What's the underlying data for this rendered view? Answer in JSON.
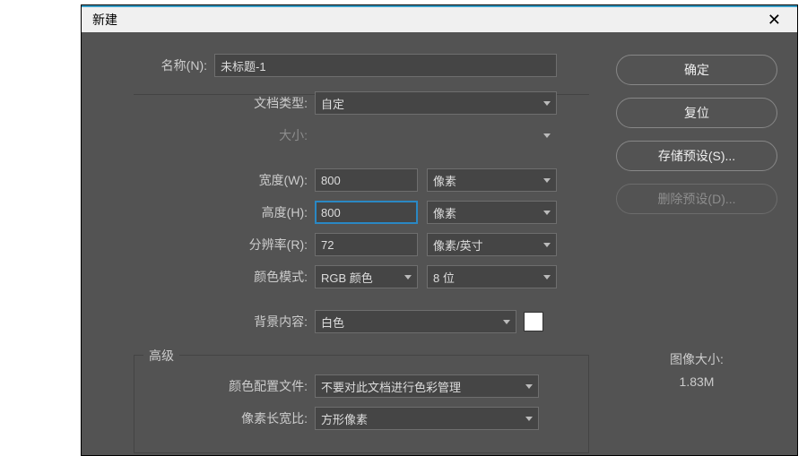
{
  "titlebar": {
    "title": "新建"
  },
  "labels": {
    "name": "名称(N):",
    "docType": "文档类型:",
    "size": "大小:",
    "width": "宽度(W):",
    "height": "高度(H):",
    "resolution": "分辨率(R):",
    "colorMode": "颜色模式:",
    "bgContent": "背景内容:",
    "advanced": "高级",
    "colorProfile": "颜色配置文件:",
    "pixelAspect": "像素长宽比:"
  },
  "values": {
    "name": "未标题-1",
    "docType": "自定",
    "width": "800",
    "widthUnit": "像素",
    "height": "800",
    "heightUnit": "像素",
    "resolution": "72",
    "resUnit": "像素/英寸",
    "colorMode": "RGB 颜色",
    "bitDepth": "8 位",
    "bgContent": "白色",
    "colorProfile": "不要对此文档进行色彩管理",
    "pixelAspect": "方形像素"
  },
  "buttons": {
    "ok": "确定",
    "reset": "复位",
    "savePreset": "存储预设(S)...",
    "deletePreset": "删除预设(D)..."
  },
  "fileSize": {
    "label": "图像大小:",
    "value": "1.83M"
  }
}
